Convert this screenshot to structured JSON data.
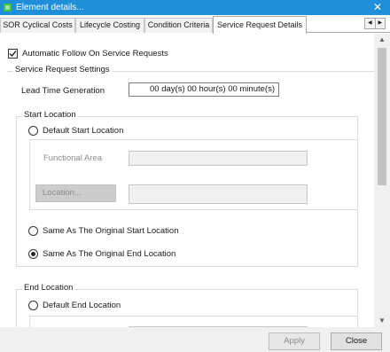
{
  "window": {
    "title": "Element details..."
  },
  "tabs": [
    {
      "label": "SOR Cyclical Costs",
      "active": false
    },
    {
      "label": "Lifecycle Costing",
      "active": false
    },
    {
      "label": "Condition Criteria",
      "active": false
    },
    {
      "label": "Service Request Details",
      "active": true
    }
  ],
  "auto_follow": {
    "label": "Automatic Follow On Service Requests",
    "checked": true
  },
  "settings_group": {
    "legend": "Service Request Settings",
    "lead_time": {
      "label": "Lead Time Generation",
      "value": "00 day(s) 00 hour(s) 00 minute(s)"
    }
  },
  "start_location": {
    "legend": "Start Location",
    "default_option": {
      "label": "Default Start Location",
      "selected": false
    },
    "functional_area": {
      "label": "Functional Area",
      "value": ""
    },
    "location_button": {
      "label": "Location...",
      "value": ""
    },
    "same_as_start": {
      "label": "Same As The Original Start Location",
      "selected": false
    },
    "same_as_end": {
      "label": "Same As The Original End Location",
      "selected": true
    }
  },
  "end_location": {
    "legend": "End Location",
    "default_option": {
      "label": "Default End Location",
      "selected": false
    }
  },
  "footer": {
    "apply_label": "Apply",
    "close_label": "Close"
  }
}
